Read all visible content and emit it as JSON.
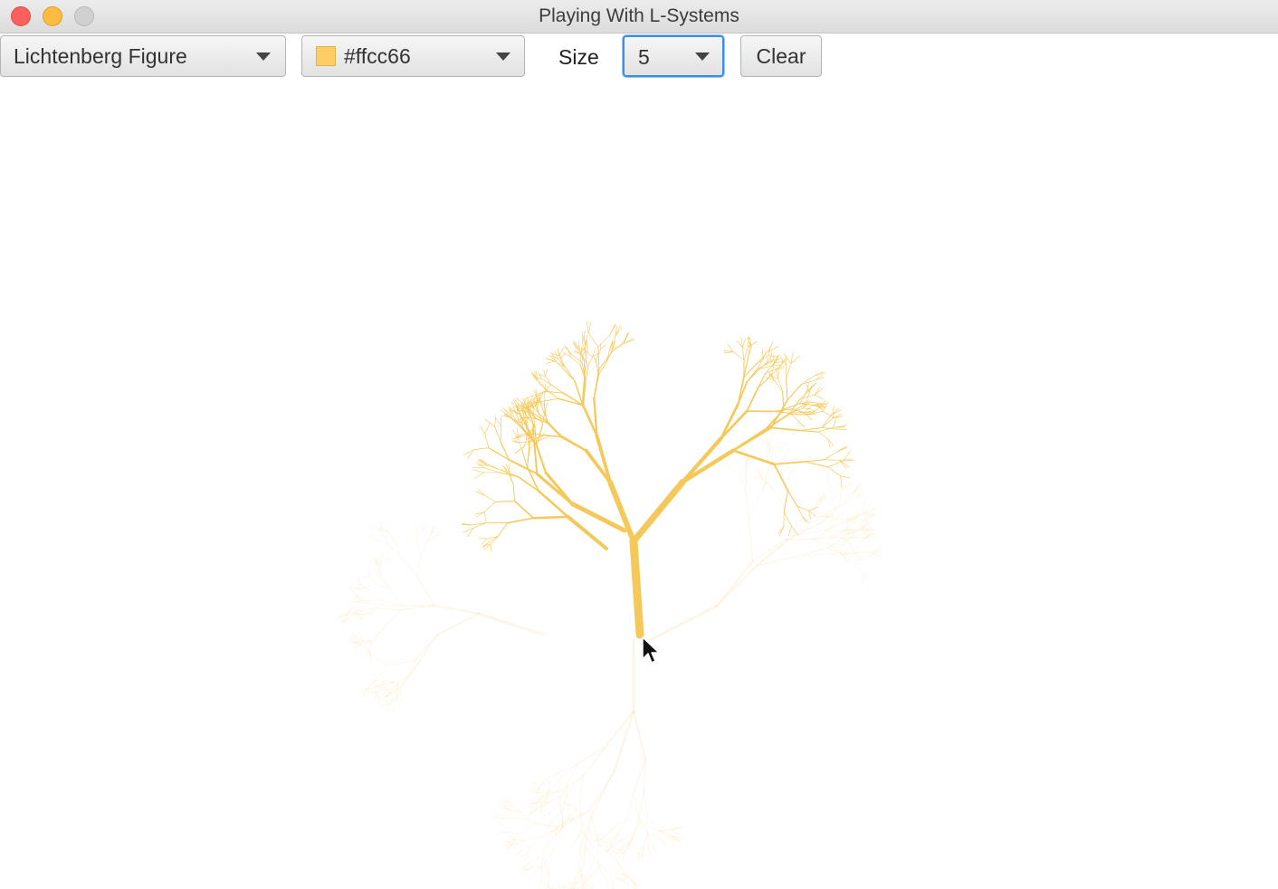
{
  "window": {
    "title": "Playing With L-Systems"
  },
  "toolbar": {
    "figure_select": {
      "value": "Lichtenberg Figure"
    },
    "color_picker": {
      "value": "#ffcc66",
      "swatch_color": "#ffcc66"
    },
    "size_label": "Size",
    "size_select": {
      "value": "5"
    },
    "clear_label": "Clear"
  },
  "canvas": {
    "stroke_color": "#f5c85a",
    "faded_color": "#f9d690"
  },
  "icons": [
    "close-traffic-light",
    "minimize-traffic-light",
    "zoom-traffic-light",
    "chevron-down-icon",
    "mouse-cursor-icon"
  ]
}
